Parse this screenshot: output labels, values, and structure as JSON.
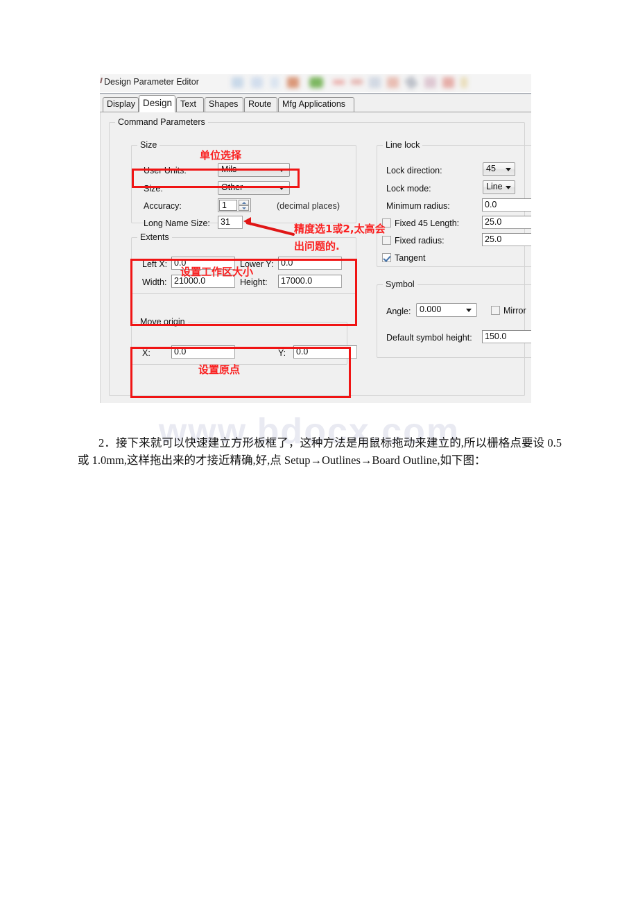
{
  "page": {
    "watermark": "www.bdocx.com"
  },
  "dialog": {
    "title": "Design Parameter Editor",
    "tabs": [
      {
        "label": "Display",
        "active": false
      },
      {
        "label": "Design",
        "active": true
      },
      {
        "label": "Text",
        "active": false
      },
      {
        "label": "Shapes",
        "active": false
      },
      {
        "label": "Route",
        "active": false
      },
      {
        "label": "Mfg Applications",
        "active": false
      }
    ],
    "command_parameters_legend": "Command Parameters",
    "size_group": {
      "legend": "Size",
      "user_units_label": "User Units:",
      "user_units_value": "Mils",
      "size_label": "Size:",
      "size_value": "Other",
      "accuracy_label": "Accuracy:",
      "accuracy_value": "1",
      "accuracy_hint": "(decimal places)",
      "long_name_size_label": "Long Name Size:",
      "long_name_size_value": "31"
    },
    "extents_group": {
      "legend": "Extents",
      "left_x_label": "Left X:",
      "left_x_value": "0.0",
      "lower_y_label": "Lower Y:",
      "lower_y_value": "0.0",
      "width_label": "Width:",
      "width_value": "21000.0",
      "height_label": "Height:",
      "height_value": "17000.0"
    },
    "move_origin_group": {
      "legend": "Move origin",
      "x_label": "X:",
      "x_value": "0.0",
      "y_label": "Y:",
      "y_value": "0.0"
    },
    "line_lock_group": {
      "legend": "Line lock",
      "lock_direction_label": "Lock direction:",
      "lock_direction_value": "45",
      "lock_mode_label": "Lock mode:",
      "lock_mode_value": "Line",
      "minimum_radius_label": "Minimum radius:",
      "minimum_radius_value": "0.0",
      "fixed_45_length_label": "Fixed 45 Length:",
      "fixed_45_length_value": "25.0",
      "fixed_45_length_checked": false,
      "fixed_radius_label": "Fixed radius:",
      "fixed_radius_value": "25.0",
      "fixed_radius_checked": false,
      "tangent_label": "Tangent",
      "tangent_checked": true
    },
    "symbol_group": {
      "legend": "Symbol",
      "angle_label": "Angle:",
      "angle_value": "0.000",
      "mirror_label": "Mirror",
      "mirror_checked": false,
      "default_symbol_height_label": "Default symbol height:",
      "default_symbol_height_value": "150.0"
    }
  },
  "annotations": {
    "unit_selection": "单位选择",
    "accuracy_note_line1": "精度选1或2,太高会",
    "accuracy_note_line2": "出问题的.",
    "work_area_size": "设置工作区大小",
    "set_origin": "设置原点",
    "accent_color": "#f01414"
  },
  "body_text": {
    "number": "2．",
    "line": "接下来就可以快速建立方形板框了，这种方法是用鼠标拖动来建立的,所以栅格点要设 0.5 或 1.0mm,这样拖出来的才接近精确,好,点 Setup→Outlines→Board Outline,如下图："
  }
}
